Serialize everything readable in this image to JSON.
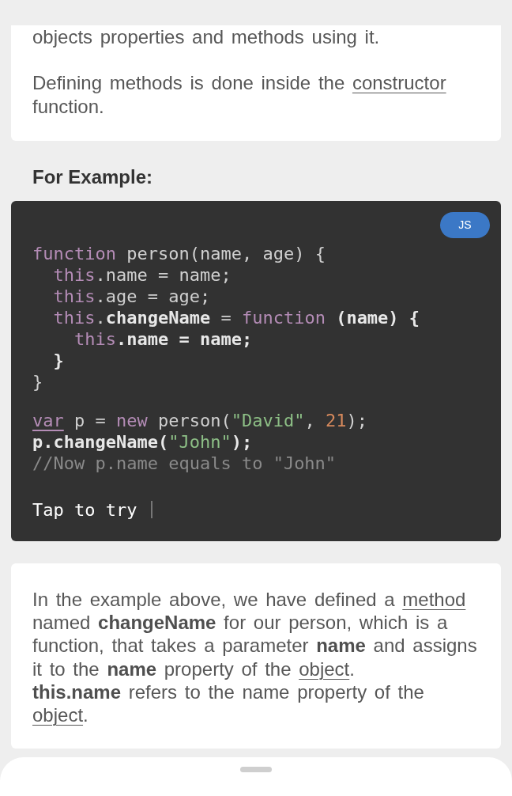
{
  "intro_card": {
    "paragraphs": [
      [
        {
          "kind": "text",
          "text": "objects properties and methods using it."
        }
      ],
      [
        {
          "kind": "text",
          "text": "Defining methods is done inside the "
        },
        {
          "kind": "link",
          "text": "constructor"
        },
        {
          "kind": "text",
          "text": " function."
        }
      ]
    ]
  },
  "example_heading": "For Example:",
  "code_example": {
    "language_badge": "JS",
    "sections": [
      {
        "lines": [
          {
            "tokens": [
              {
                "kind": "keyword",
                "text": "function",
                "underlined": false
              },
              {
                "kind": "plain",
                "text": " person(name, age) {",
                "underlined": false
              }
            ],
            "children": [
              {
                "tokens": [
                  {
                    "kind": "keyword",
                    "text": "this",
                    "underlined": false
                  },
                  {
                    "kind": "plain",
                    "text": ".name = name;",
                    "underlined": false
                  }
                ]
              },
              {
                "tokens": [
                  {
                    "kind": "keyword",
                    "text": "this",
                    "underlined": false
                  },
                  {
                    "kind": "plain",
                    "text": ".age = age;",
                    "underlined": false
                  }
                ]
              },
              {
                "tokens": [
                  {
                    "kind": "keyword",
                    "text": "this",
                    "underlined": false
                  },
                  {
                    "kind": "plain",
                    "text": ".",
                    "underlined": false
                  },
                  {
                    "kind": "bright",
                    "text": "changeName",
                    "underlined": false
                  },
                  {
                    "kind": "plain",
                    "text": " = ",
                    "underlined": false
                  },
                  {
                    "kind": "keyword",
                    "text": "function",
                    "underlined": false
                  },
                  {
                    "kind": "bright",
                    "text": " (name) {",
                    "underlined": false
                  }
                ],
                "children": [
                  {
                    "tokens": [
                      {
                        "kind": "keyword",
                        "text": "this",
                        "underlined": false
                      },
                      {
                        "kind": "bright",
                        "text": ".name = name;",
                        "underlined": false
                      }
                    ]
                  }
                ]
              },
              {
                "tokens": [
                  {
                    "kind": "bright",
                    "text": "}",
                    "underlined": false
                  }
                ]
              }
            ]
          },
          {
            "tokens": [
              {
                "kind": "plain",
                "text": "}",
                "underlined": false
              }
            ]
          }
        ]
      },
      {
        "lines": [
          {
            "tokens": [
              {
                "kind": "keyword",
                "text": "var",
                "underlined": true
              },
              {
                "kind": "plain",
                "text": " p = ",
                "underlined": false
              },
              {
                "kind": "keyword",
                "text": "new",
                "underlined": false
              },
              {
                "kind": "plain",
                "text": " person(",
                "underlined": false
              },
              {
                "kind": "string",
                "text": "\"David\"",
                "underlined": false
              },
              {
                "kind": "plain",
                "text": ", ",
                "underlined": false
              },
              {
                "kind": "number",
                "text": "21",
                "underlined": false
              },
              {
                "kind": "plain",
                "text": ");",
                "underlined": false
              }
            ]
          },
          {
            "tokens": [
              {
                "kind": "bright",
                "text": "p.changeName(",
                "underlined": false
              },
              {
                "kind": "string",
                "text": "\"John\"",
                "underlined": false
              },
              {
                "kind": "bright",
                "text": ");",
                "underlined": false
              }
            ]
          },
          {
            "tokens": [
              {
                "kind": "comment",
                "text": "//Now p.name equals to \"John\"",
                "underlined": false
              }
            ]
          }
        ]
      }
    ],
    "try_prompt": "Tap to try"
  },
  "explanation_card": {
    "paragraphs": [
      [
        {
          "kind": "text",
          "text": "In the example above, we have defined a "
        },
        {
          "kind": "link",
          "text": "method"
        },
        {
          "kind": "text",
          "text": " named **changeName** for our person, which is a function, that takes a parameter **name** and assigns it to the **name** property of the "
        },
        {
          "kind": "link",
          "text": "object"
        },
        {
          "kind": "text",
          "text": ".\n**this.name** refers to the name property of the "
        },
        {
          "kind": "link",
          "text": "object"
        },
        {
          "kind": "text",
          "text": "."
        }
      ]
    ]
  },
  "bottom_sheet": {
    "handle": true
  }
}
